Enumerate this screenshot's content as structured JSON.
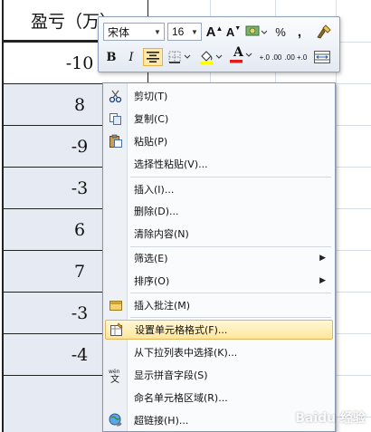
{
  "sheet": {
    "header": "盈亏（万）",
    "values": [
      "-10",
      "8",
      "-9",
      "-3",
      "6",
      "7",
      "-3",
      "-4"
    ]
  },
  "mini_toolbar": {
    "font_name": "宋体",
    "font_size": "16",
    "grow_font": "A",
    "shrink_font": "A",
    "percent": "%",
    "comma": ",",
    "bold": "B",
    "italic": "I",
    "font_color_letter": "A",
    "inc_decimal": "+.0 .00",
    "dec_decimal": ".00 +.0"
  },
  "menu": {
    "cut": "剪切(T)",
    "copy": "复制(C)",
    "paste": "粘贴(P)",
    "paste_special": "选择性粘贴(V)...",
    "insert": "插入(I)...",
    "delete": "删除(D)...",
    "clear": "清除内容(N)",
    "filter": "筛选(E)",
    "sort": "排序(O)",
    "insert_comment": "插入批注(M)",
    "format_cells": "设置单元格格式(F)...",
    "pick_list": "从下拉列表中选择(K)...",
    "phonetic": "显示拼音字段(S)",
    "define_name": "命名单元格区域(R)...",
    "hyperlink": "超链接(H)..."
  },
  "watermark": "Baidu 经验",
  "colors": {
    "highlight": "#ffe69a",
    "selection": "#e6ebf3",
    "menu_border": "#8996ad"
  }
}
